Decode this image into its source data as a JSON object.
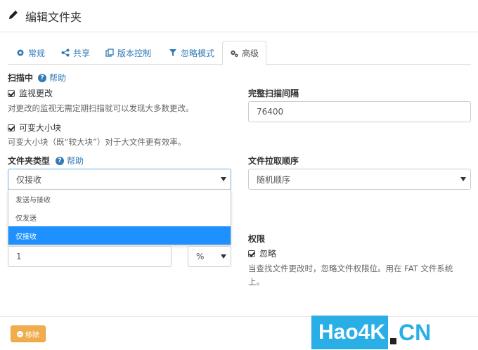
{
  "header": {
    "title": "编辑文件夹",
    "icon": "pencil-icon"
  },
  "tabs": [
    {
      "label": "常规",
      "icon": "gear-icon"
    },
    {
      "label": "共享",
      "icon": "share-icon"
    },
    {
      "label": "版本控制",
      "icon": "copy-icon"
    },
    {
      "label": "忽略模式",
      "icon": "filter-icon"
    },
    {
      "label": "高级",
      "icon": "gears-icon"
    }
  ],
  "scan": {
    "title": "扫描中",
    "help": "帮助",
    "watch_label": "监视更改",
    "watch_desc": "对更改的监视无需定期扫描就可以发现大多数更改。",
    "variable_label": "可变大小块",
    "variable_desc": "可变大小块（既“较大块”）对于大文件更有效率。"
  },
  "full_scan": {
    "label": "完整扫描间隔",
    "value": "76400"
  },
  "folder_type": {
    "label": "文件夹类型",
    "help": "帮助",
    "selected": "仅接收",
    "options": [
      "发送与接收",
      "仅发送",
      "仅接收"
    ]
  },
  "pull_order": {
    "label": "文件拉取顺序",
    "selected": "随机顺序"
  },
  "min_disk": {
    "value": "1",
    "unit": "%"
  },
  "permissions": {
    "title": "权限",
    "ignore_label": "忽略",
    "desc_line1": "当查找文件更改时，忽略文件权限位。用在 FAT 文件系统",
    "desc_line2": "上。"
  },
  "footer": {
    "remove_label": "移除"
  },
  "watermark": {
    "main": "Hao4K",
    "suffix": "CN"
  },
  "colors": {
    "link": "#337ab7",
    "selected": "#1e90ff",
    "warning": "#f0ad4e",
    "watermark": "#29aee6"
  }
}
